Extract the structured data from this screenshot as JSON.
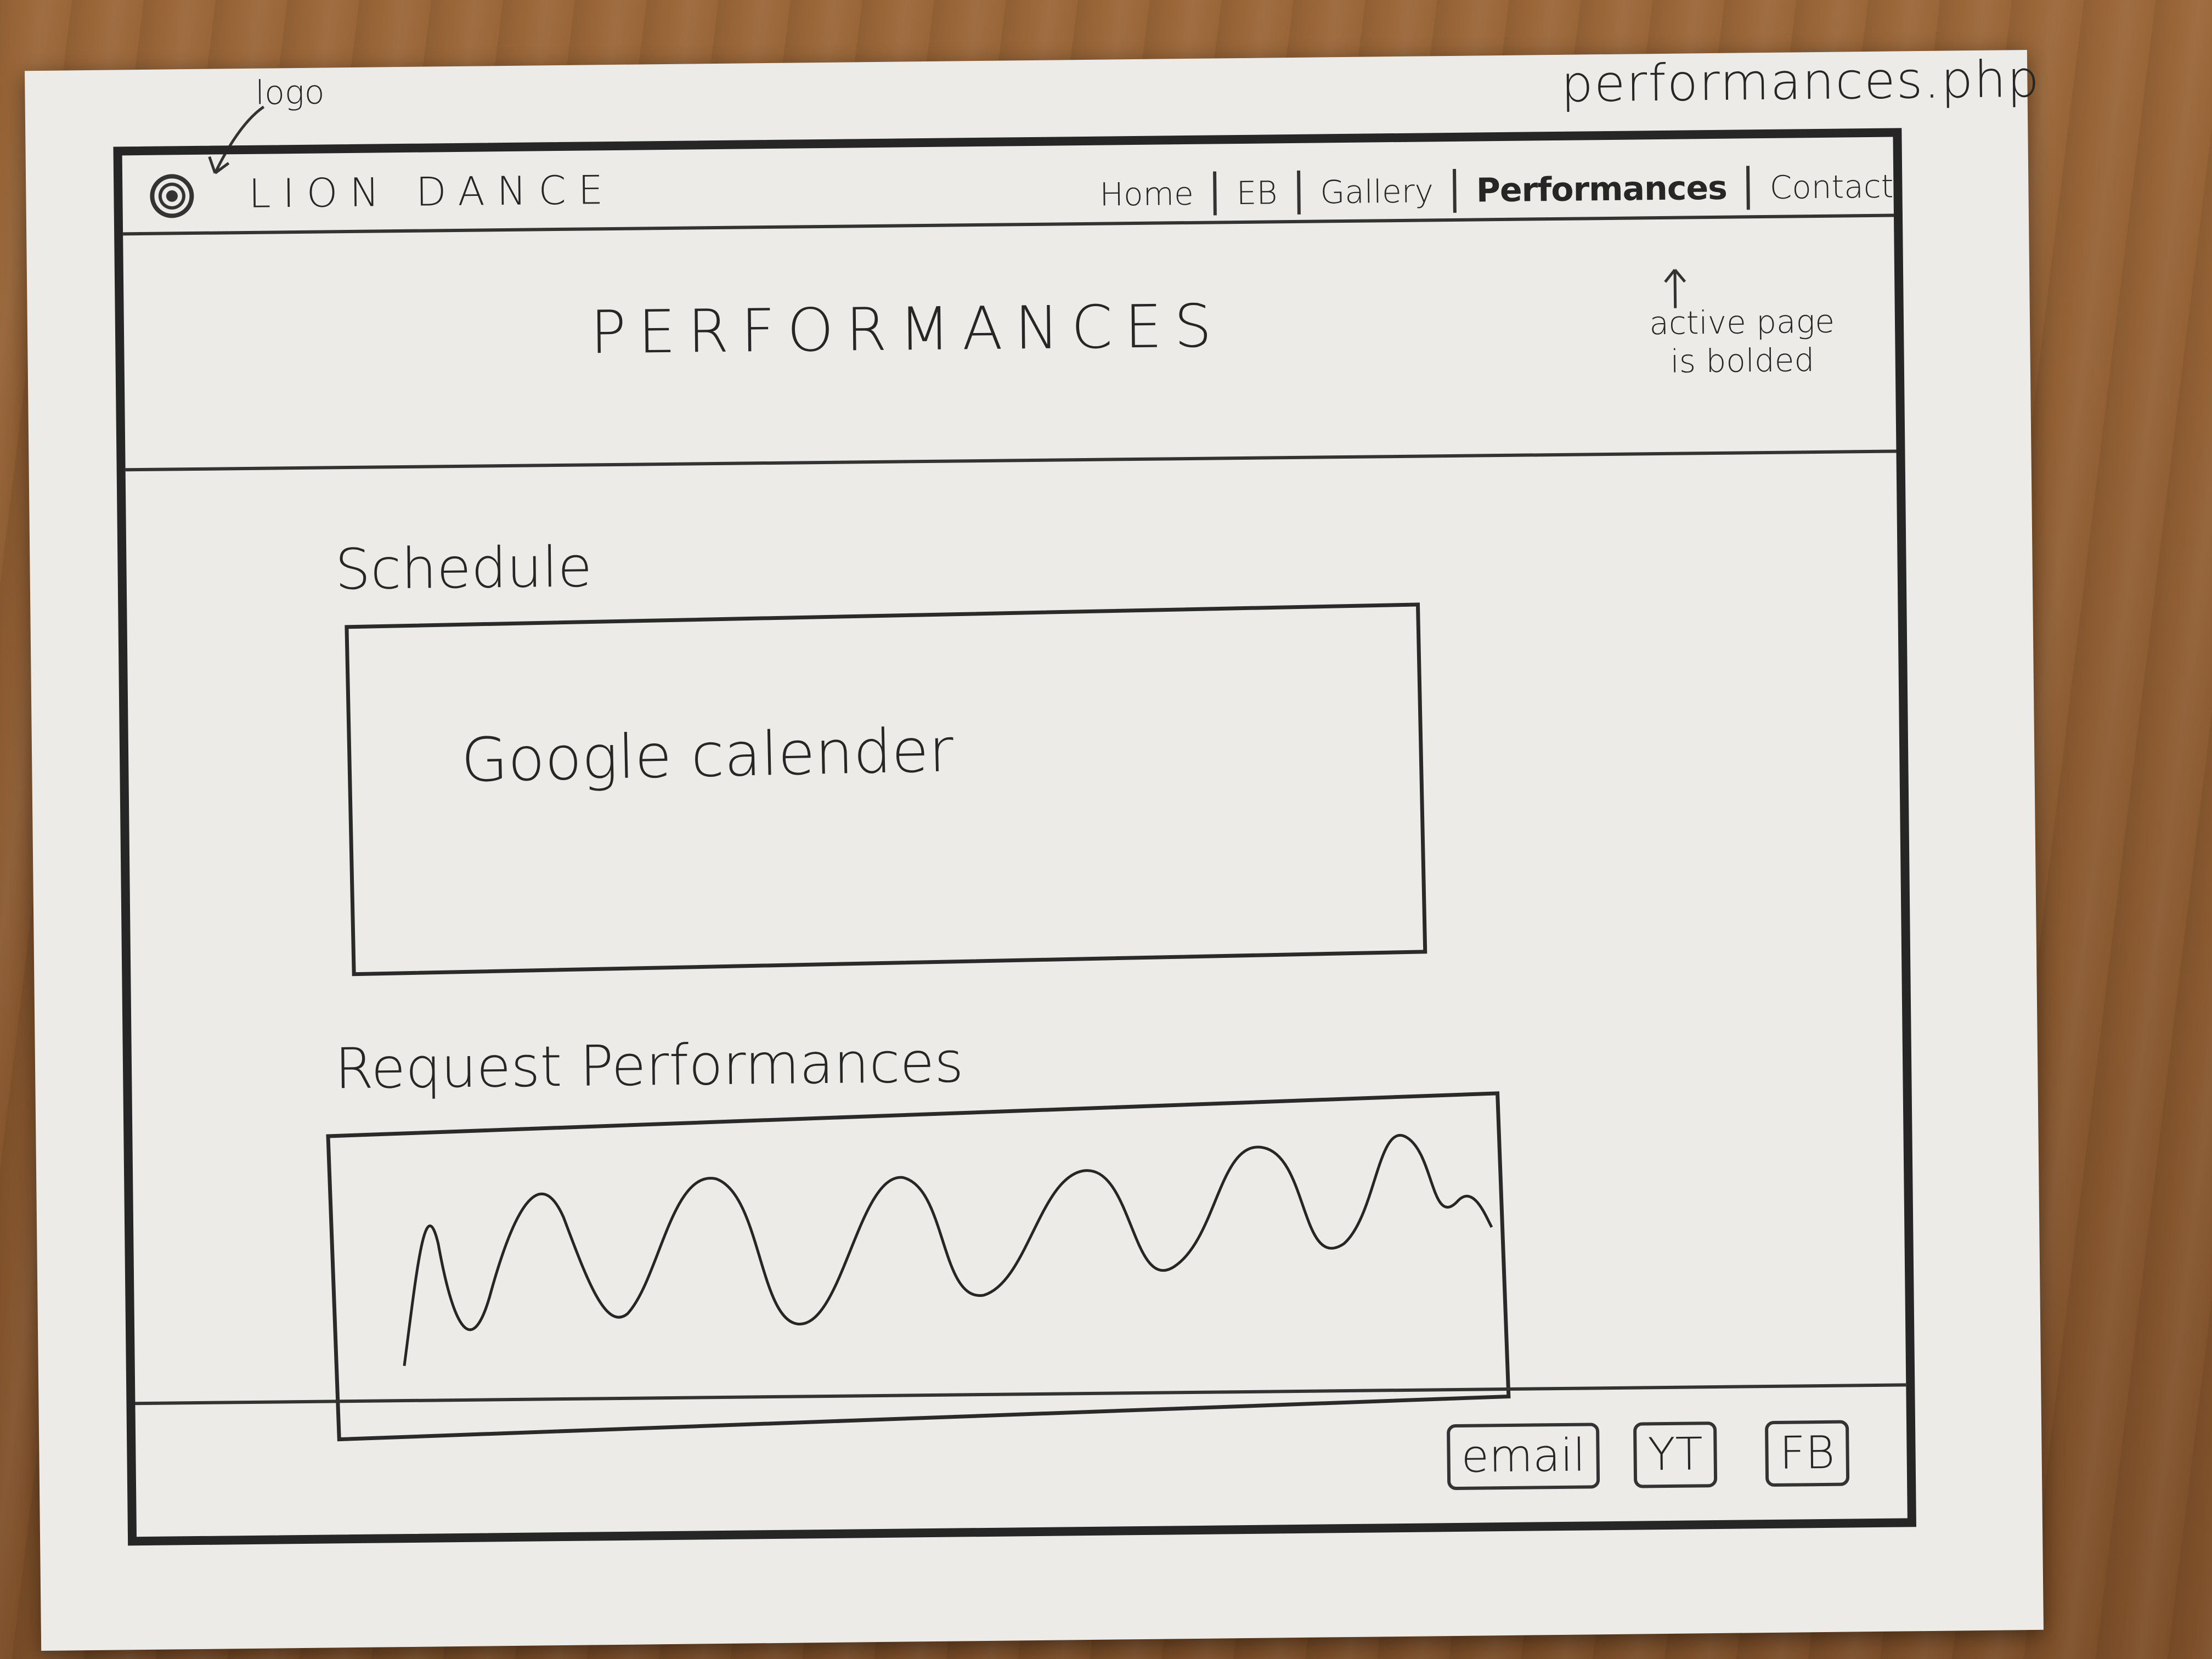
{
  "annotations": {
    "filename": "performances.php",
    "logo_note": "logo",
    "active_note_line1": "active page",
    "active_note_line2": "is bolded"
  },
  "header": {
    "site_title": "LION DANCE",
    "nav": {
      "home": "Home",
      "eb": "EB",
      "gallery": "Gallery",
      "performances": "Performances",
      "contact": "Contact"
    }
  },
  "hero": {
    "title": "PERFORMANCES"
  },
  "schedule": {
    "label": "Schedule",
    "placeholder": "Google calender"
  },
  "request": {
    "label": "Request Performances"
  },
  "footer": {
    "email": "email",
    "youtube": "YT",
    "facebook": "FB"
  }
}
